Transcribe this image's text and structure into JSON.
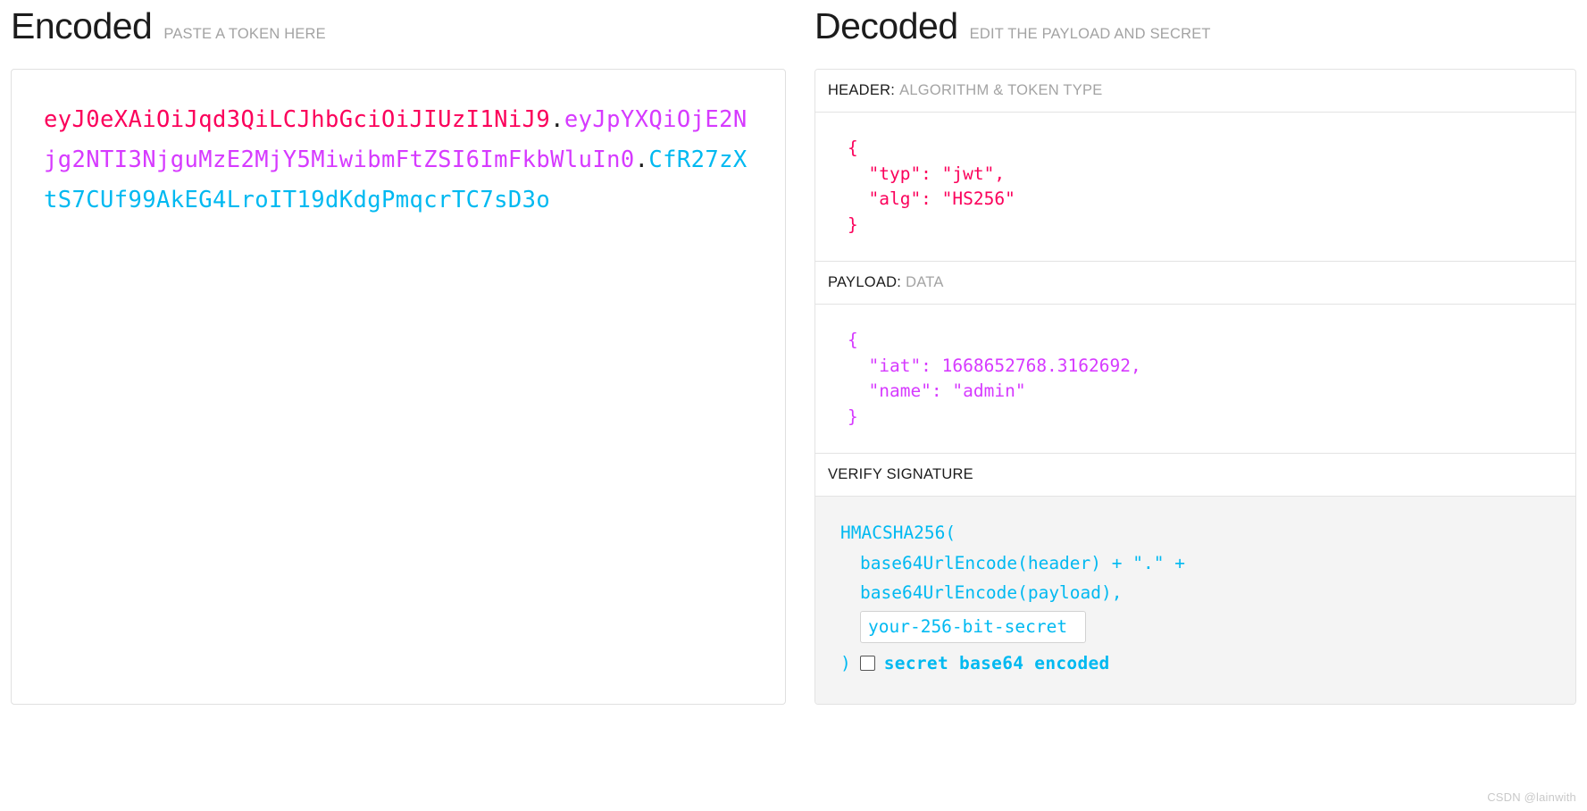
{
  "encoded": {
    "title": "Encoded",
    "subtitle": "PASTE A TOKEN HERE",
    "token": {
      "header_part": "eyJ0eXAiOiJqd3QiLCJhbGciOiJIUzI1NiJ9",
      "dot1": ".",
      "payload_part": "eyJpYXQiOjE2Njg2NTI3NjguMzE2MjY5MiwibmFtZSI6ImFkbWluIn0",
      "dot2": ".",
      "signature_part": "CfR27zXtS7CUf99AkEG4LroIT19dKdgPmqcrTC7sD3o"
    },
    "colors": {
      "header": "#fb015b",
      "payload": "#d63aff",
      "signature": "#00b9f1"
    }
  },
  "decoded": {
    "title": "Decoded",
    "subtitle": "EDIT THE PAYLOAD AND SECRET",
    "header_section": {
      "label_main": "HEADER:",
      "label_sub": "ALGORITHM & TOKEN TYPE",
      "json": "{\n  \"typ\": \"jwt\",\n  \"alg\": \"HS256\"\n}"
    },
    "payload_section": {
      "label_main": "PAYLOAD:",
      "label_sub": "DATA",
      "json": "{\n  \"iat\": 1668652768.3162692,\n  \"name\": \"admin\"\n}"
    },
    "signature_section": {
      "label_main": "VERIFY SIGNATURE",
      "label_sub": "",
      "line1": "HMACSHA256(",
      "line2": "base64UrlEncode(header) + \".\" +",
      "line3": "base64UrlEncode(payload),",
      "secret_value": "your-256-bit-secret",
      "secret_placeholder": "your-256-bit-secret",
      "closing_paren": ")",
      "base64_checkbox_label": "secret base64 encoded",
      "base64_checked": false
    }
  },
  "watermark": "CSDN @lainwith"
}
